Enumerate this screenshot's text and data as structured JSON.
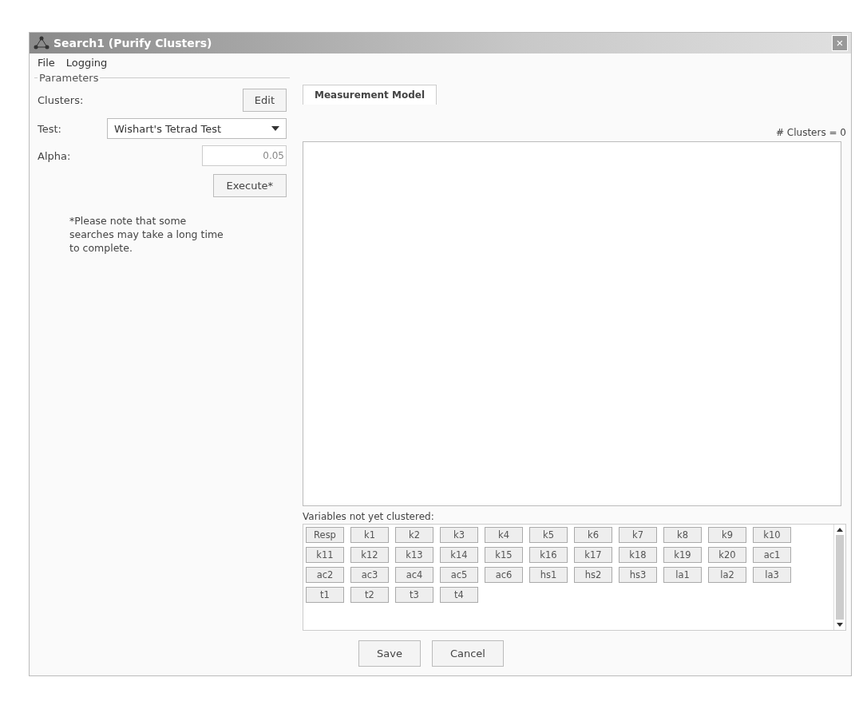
{
  "window": {
    "title": "Search1 (Purify Clusters)",
    "close": "×"
  },
  "menu": [
    "File",
    "Logging"
  ],
  "parameters": {
    "title": "Parameters",
    "clusters_label": "Clusters:",
    "edit_button": "Edit",
    "test_label": "Test:",
    "test_value": "Wishart's Tetrad Test",
    "alpha_label": "Alpha:",
    "alpha_value": "0.05",
    "execute_button": "Execute*",
    "note": "*Please note that some searches may take a long time to complete."
  },
  "tabs": [
    {
      "label": "Measurement Model",
      "selected": true
    }
  ],
  "cluster_count": "# Clusters = 0",
  "variables_label": "Variables not yet clustered:",
  "variables": [
    "Resp",
    "k1",
    "k2",
    "k3",
    "k4",
    "k5",
    "k6",
    "k7",
    "k8",
    "k9",
    "k10",
    "k11",
    "k12",
    "k13",
    "k14",
    "k15",
    "k16",
    "k17",
    "k18",
    "k19",
    "k20",
    "ac1",
    "ac2",
    "ac3",
    "ac4",
    "ac5",
    "ac6",
    "hs1",
    "hs2",
    "hs3",
    "la1",
    "la2",
    "la3",
    "t1",
    "t2",
    "t3",
    "t4"
  ],
  "buttons": [
    "Save",
    "Cancel"
  ]
}
